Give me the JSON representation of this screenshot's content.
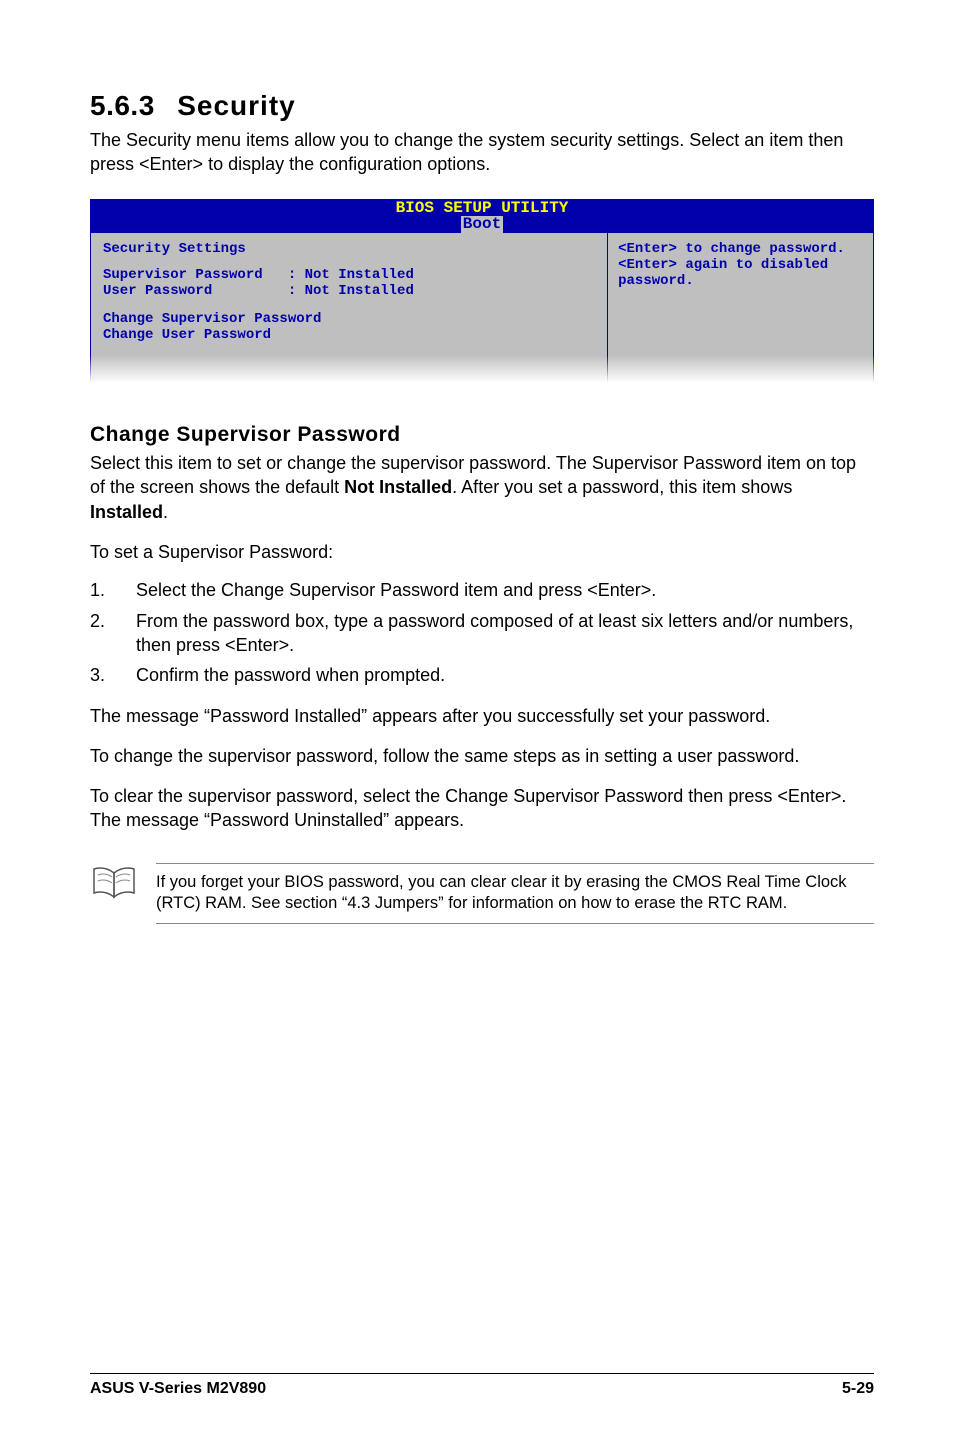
{
  "section": {
    "number": "5.6.3",
    "title": "Security"
  },
  "intro": "The Security menu items allow you to change the system security settings. Select an item then press <Enter> to display the configuration options.",
  "bios": {
    "title": "BIOS SETUP UTILITY",
    "tab": "Boot",
    "left": {
      "heading": "Security Settings",
      "rows": [
        "Supervisor Password   : Not Installed",
        "User Password         : Not Installed"
      ],
      "rows2": [
        "Change Supervisor Password",
        "Change User Password"
      ]
    },
    "right": "<Enter> to change password.\n<Enter> again to disabled password."
  },
  "subhead": "Change Supervisor Password",
  "p1a": "Select this item to set or change the supervisor password. The Supervisor Password item on top of the screen shows the default ",
  "p1_bold1": "Not Installed",
  "p1b": ". After you set a password, this item shows ",
  "p1_bold2": "Installed",
  "p1c": ".",
  "p2": "To set a Supervisor Password:",
  "steps": [
    {
      "n": "1.",
      "t": "Select the Change Supervisor Password item and press <Enter>."
    },
    {
      "n": "2.",
      "t": "From the password box, type a password composed of at least six letters and/or numbers, then press <Enter>."
    },
    {
      "n": "3.",
      "t": "Confirm the password when prompted."
    }
  ],
  "p3": "The message “Password Installed” appears after you successfully set your password.",
  "p4": "To change the supervisor password, follow the same steps as in setting a user password.",
  "p5": "To clear the supervisor password, select the Change Supervisor Password then press <Enter>. The message “Password Uninstalled” appears.",
  "note": "If you forget your BIOS password, you can clear clear it by erasing the CMOS Real Time Clock (RTC) RAM. See section “4.3  Jumpers” for information on how to erase the RTC RAM.",
  "footer": {
    "left": "ASUS V-Series M2V890",
    "right": "5-29"
  }
}
